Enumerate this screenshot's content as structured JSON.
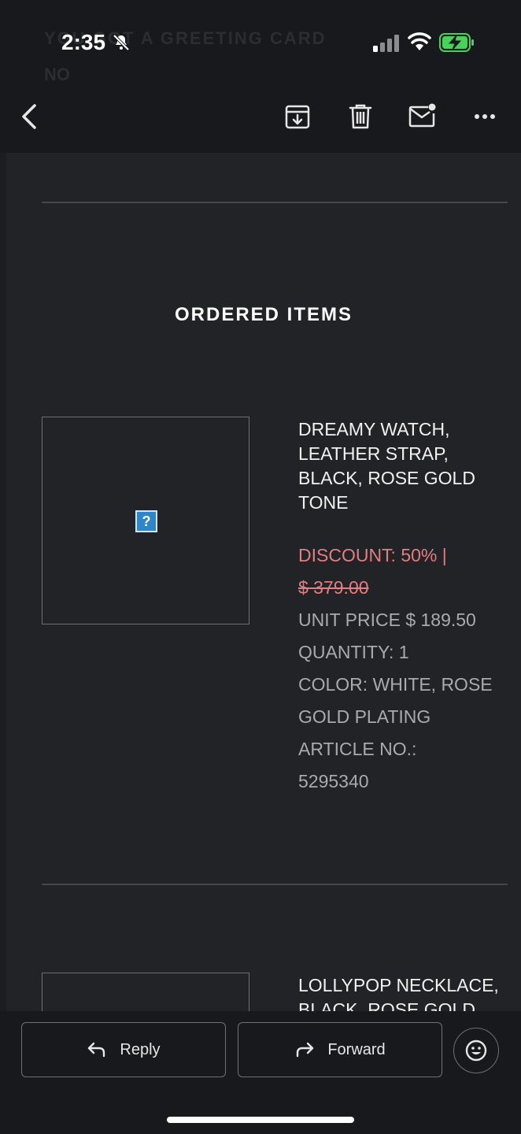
{
  "status_bar": {
    "time": "2:35"
  },
  "ghost_header": {
    "line1": "YOU GOT A GREETING CARD",
    "line2": "NO"
  },
  "toolbar": {
    "icons": [
      "back-icon",
      "archive-icon",
      "trash-icon",
      "mail-icon",
      "more-icon"
    ]
  },
  "email": {
    "section_title": "ORDERED ITEMS",
    "items": [
      {
        "name_lines": [
          "DREAMY WATCH,",
          "LEATHER STRAP,",
          "BLACK, ROSE GOLD",
          "TONE"
        ],
        "discount": "DISCOUNT: 50% |",
        "old_price": "$ 379.00",
        "unit_price": "UNIT PRICE $ 189.50",
        "quantity": "QUANTITY: 1",
        "color_line1": "COLOR: WHITE, ROSE",
        "color_line2": "GOLD PLATING",
        "article_label": "ARTICLE NO.:",
        "article_number": "5295340",
        "image_placeholder": "?"
      },
      {
        "name_lines": [
          "LOLLYPOP NECKLACE,",
          "BLACK, ROSE GOLD"
        ]
      }
    ]
  },
  "bottom_bar": {
    "reply_label": "Reply",
    "forward_label": "Forward"
  },
  "colors": {
    "background": "#222327",
    "bar_background": "#18191c",
    "discount": "#e47d81",
    "battery_charging": "#46d35a"
  }
}
